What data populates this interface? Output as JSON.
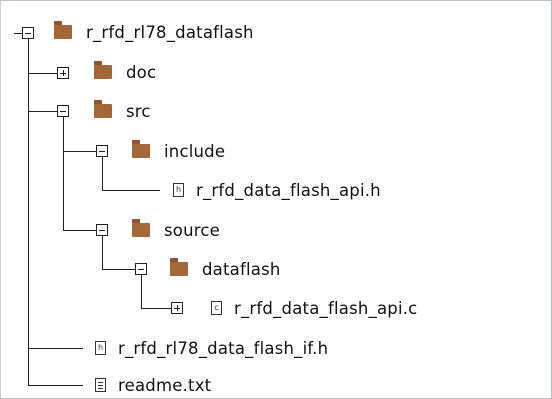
{
  "tree": {
    "root": {
      "label": "r_rfd_rl78_dataflash",
      "icon": "folder-icon",
      "state": "expanded"
    },
    "doc": {
      "label": "doc",
      "icon": "folder-icon",
      "state": "collapsed"
    },
    "src": {
      "label": "src",
      "icon": "folder-icon",
      "state": "expanded"
    },
    "include": {
      "label": "include",
      "icon": "folder-icon",
      "state": "expanded"
    },
    "include_file": {
      "label": "r_rfd_data_flash_api.h",
      "icon": "header-file-icon",
      "glyph": "h"
    },
    "source": {
      "label": "source",
      "icon": "folder-icon",
      "state": "expanded"
    },
    "dataflash": {
      "label": "dataflash",
      "icon": "folder-icon",
      "state": "expanded"
    },
    "dataflash_file": {
      "label": "r_rfd_data_flash_api.c",
      "icon": "c-file-icon",
      "glyph": "c",
      "state": "collapsed"
    },
    "if_file": {
      "label": "r_rfd_rl78_data_flash_if.h",
      "icon": "header-file-icon",
      "glyph": "h"
    },
    "readme": {
      "label": "readme.txt",
      "icon": "text-file-icon"
    }
  },
  "colors": {
    "folder": "#a3673a",
    "lines": "#222222",
    "text": "#111111"
  }
}
